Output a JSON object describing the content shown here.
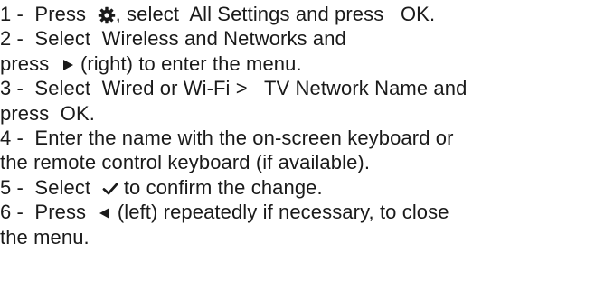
{
  "steps": [
    {
      "num": "1 -",
      "t1": "Press",
      "t2": ", select",
      "k1": "All Settings",
      "t3": "and press",
      "k2": "OK",
      "t4": "."
    },
    {
      "num": "2 -",
      "t1": "Select",
      "k1": "Wireless and Networks",
      "t2": "and",
      "t3": "press",
      "t4": "(right) to enter the menu."
    },
    {
      "num": "3 -",
      "t1": "Select",
      "k1": "Wired or Wi-Fi",
      "t2": ">",
      "k2": "TV Network Name",
      "t3": "and",
      "t4": "press",
      "k3": "OK",
      "t5": "."
    },
    {
      "num": "4 -",
      "t1": "Enter the name with the on-screen keyboard or",
      "t2": "the remote control keyboard (if available)."
    },
    {
      "num": "5 -",
      "t1": "Select",
      "t2": "to confirm the change."
    },
    {
      "num": "6 -",
      "t1": "Press",
      "t2": "(left) repeatedly if necessary, to close",
      "t3": "the menu."
    }
  ],
  "icons": {
    "settings": "gear-icon",
    "right": "arrow-right-icon",
    "check": "checkmark-icon",
    "left": "arrow-left-icon"
  },
  "colors": {
    "text": "#1a1a1a",
    "background": "#ffffff"
  }
}
